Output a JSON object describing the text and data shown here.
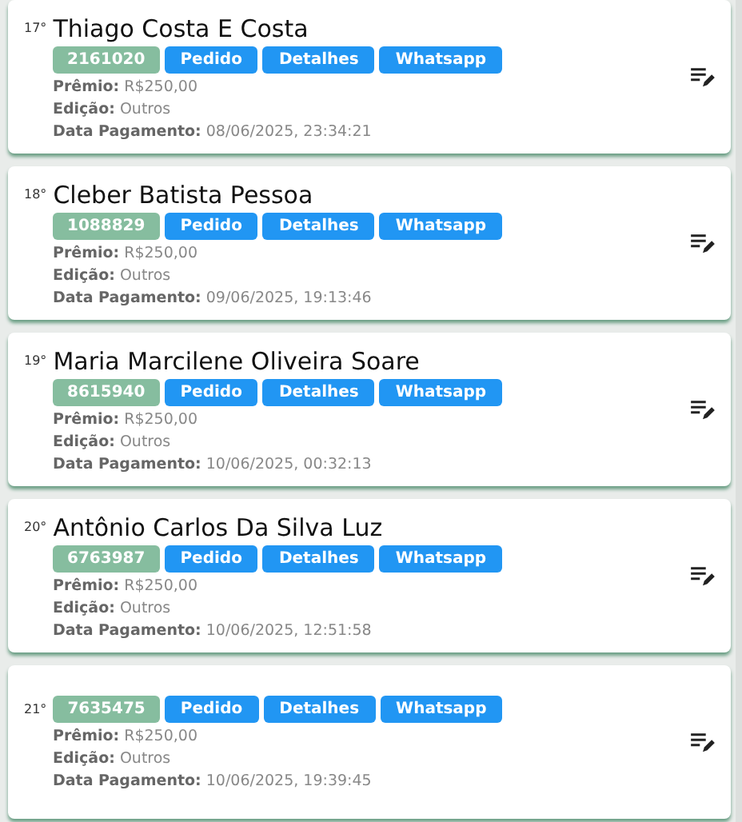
{
  "entries": [
    {
      "rank": "17°",
      "name": "Thiago Costa E Costa",
      "code": "2161020",
      "buttons": [
        "Pedido",
        "Detalhes",
        "Whatsapp"
      ],
      "fields": [
        {
          "label": "Prêmio:",
          "value": "R$250,00"
        },
        {
          "label": "Edição:",
          "value": "Outros"
        },
        {
          "label": "Data Pagamento:",
          "value": "08/06/2025, 23:34:21"
        }
      ]
    },
    {
      "rank": "18°",
      "name": "Cleber Batista Pessoa",
      "code": "1088829",
      "buttons": [
        "Pedido",
        "Detalhes",
        "Whatsapp"
      ],
      "fields": [
        {
          "label": "Prêmio:",
          "value": "R$250,00"
        },
        {
          "label": "Edição:",
          "value": "Outros"
        },
        {
          "label": "Data Pagamento:",
          "value": "09/06/2025, 19:13:46"
        }
      ]
    },
    {
      "rank": "19°",
      "name": "Maria Marcilene Oliveira Soare",
      "code": "8615940",
      "buttons": [
        "Pedido",
        "Detalhes",
        "Whatsapp"
      ],
      "fields": [
        {
          "label": "Prêmio:",
          "value": "R$250,00"
        },
        {
          "label": "Edição:",
          "value": "Outros"
        },
        {
          "label": "Data Pagamento:",
          "value": "10/06/2025, 00:32:13"
        }
      ]
    },
    {
      "rank": "20°",
      "name": "Antônio Carlos Da Silva Luz",
      "code": "6763987",
      "buttons": [
        "Pedido",
        "Detalhes",
        "Whatsapp"
      ],
      "fields": [
        {
          "label": "Prêmio:",
          "value": "R$250,00"
        },
        {
          "label": "Edição:",
          "value": "Outros"
        },
        {
          "label": "Data Pagamento:",
          "value": "10/06/2025, 12:51:58"
        }
      ]
    },
    {
      "rank": "21°",
      "code": "7635475",
      "buttons": [
        "Pedido",
        "Detalhes",
        "Whatsapp"
      ],
      "fields": [
        {
          "label": "Prêmio:",
          "value": "R$250,00"
        },
        {
          "label": "Edição:",
          "value": "Outros"
        },
        {
          "label": "Data Pagamento:",
          "value": "10/06/2025, 19:39:45"
        }
      ]
    }
  ]
}
